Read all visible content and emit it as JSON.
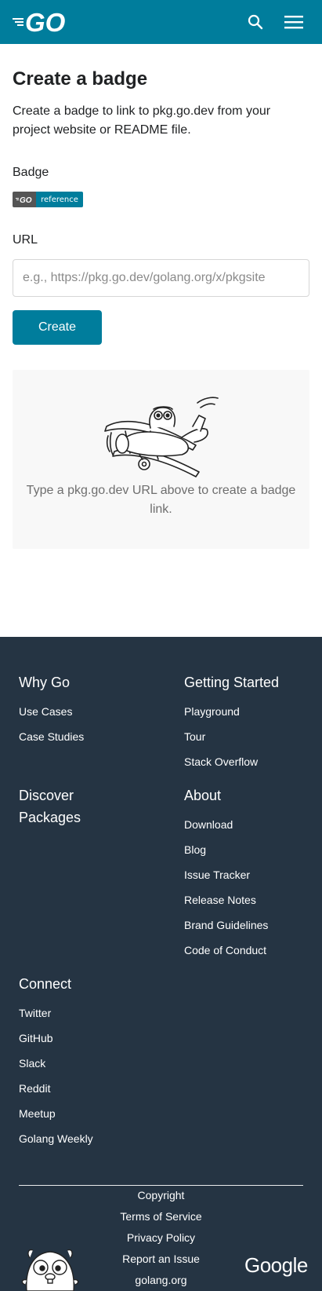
{
  "header": {
    "logo_text": "GO",
    "search_icon": "search-icon",
    "menu_icon": "hamburger-menu-icon",
    "background": "#007d9c"
  },
  "main": {
    "title": "Create a badge",
    "intro": "Create a badge to link to pkg.go.dev from your project website or README file.",
    "badge_label": "Badge",
    "badge": {
      "left_text": "GO",
      "right_text": "reference",
      "right_color": "#007d9c",
      "left_color": "#555555"
    },
    "url_label": "URL",
    "url_placeholder": "e.g., https://pkg.go.dev/golang.org/x/pkgsite",
    "url_value": "",
    "create_button": "Create",
    "result_text": "Type a pkg.go.dev URL above to create a badge link."
  },
  "footer": {
    "background": "#253443",
    "columns": [
      {
        "heading": "Why Go",
        "links": [
          "Use Cases",
          "Case Studies"
        ]
      },
      {
        "heading": "Getting Started",
        "links": [
          "Playground",
          "Tour",
          "Stack Overflow"
        ]
      },
      {
        "heading": "Discover Packages",
        "links": []
      },
      {
        "heading": "About",
        "links": [
          "Download",
          "Blog",
          "Issue Tracker",
          "Release Notes",
          "Brand Guidelines",
          "Code of Conduct"
        ]
      },
      {
        "heading": "Connect",
        "links": [
          "Twitter",
          "GitHub",
          "Slack",
          "Reddit",
          "Meetup",
          "Golang Weekly"
        ]
      }
    ],
    "bottom_links": [
      "Copyright",
      "Terms of Service",
      "Privacy Policy",
      "Report an Issue",
      "golang.org"
    ],
    "google_logo": "Google"
  }
}
